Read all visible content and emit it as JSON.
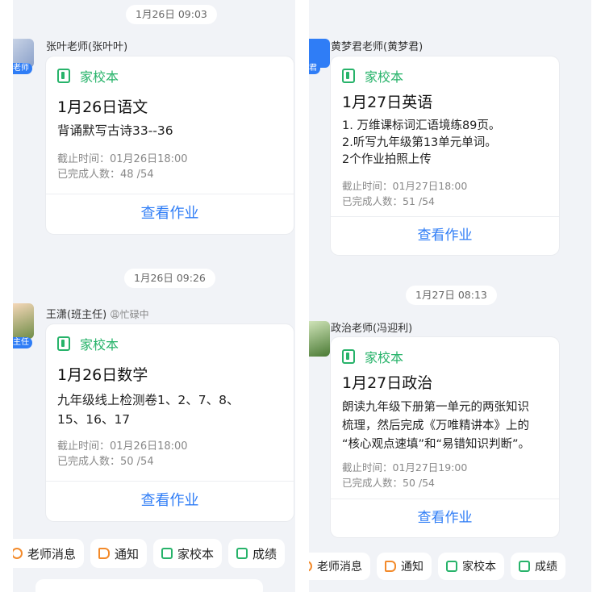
{
  "left": {
    "top_time": "1月26日 09:03",
    "messages": [
      {
        "avatar_tag": "老师",
        "sender": "张叶老师(张叶叶)",
        "busy": "",
        "app_name": "家校本",
        "title": "1月26日语文",
        "body": [
          "背诵默写古诗33--36"
        ],
        "deadline": "截止时间：01月26日18:00",
        "completed": "已完成人数：48 /54",
        "action": "查看作业"
      },
      {
        "time": "1月26日 09:26",
        "avatar_tag": "主任",
        "sender": "王潇(班主任)",
        "busy": "😩忙碌中",
        "app_name": "家校本",
        "title": "1月26日数学",
        "body": [
          "九年级线上检测卷1、2、7、8、",
          "15、16、17"
        ],
        "deadline": "截止时间：01月26日18:00",
        "completed": "已完成人数：50 /54",
        "action": "查看作业"
      }
    ],
    "toolbar": [
      {
        "icon": "message-icon",
        "label": "老师消息"
      },
      {
        "icon": "notice-icon",
        "label": "通知"
      },
      {
        "icon": "homework-icon",
        "label": "家校本"
      },
      {
        "icon": "grade-icon",
        "label": "成绩"
      }
    ]
  },
  "right": {
    "messages": [
      {
        "avatar_tag": "君",
        "sender": "黄梦君老师(黄梦君)",
        "busy": "",
        "app_name": "家校本",
        "title": "1月27日英语",
        "body": [
          "1. 万维课标词汇语境练89页。",
          "2.听写九年级第13单元单词。",
          "2个作业拍照上传"
        ],
        "deadline": "截止时间：01月27日18:00",
        "completed": "已完成人数：51 /54",
        "action": "查看作业"
      },
      {
        "time": "1月27日 08:13",
        "avatar_tag": "",
        "sender": "政治老师(冯迎利)",
        "busy": "",
        "app_name": "家校本",
        "title": "1月27日政治",
        "body": [
          "朗读九年级下册第一单元的两张知识",
          "梳理，然后完成《万唯精讲本》上的",
          "“核心观点速填”和“易错知识判断”。"
        ],
        "deadline": "截止时间：01月27日19:00",
        "completed": "已完成人数：50 /54",
        "action": "查看作业"
      }
    ],
    "toolbar": [
      {
        "icon": "message-icon",
        "label": "老师消息"
      },
      {
        "icon": "notice-icon",
        "label": "通知"
      },
      {
        "icon": "homework-icon",
        "label": "家校本"
      },
      {
        "icon": "grade-icon",
        "label": "成绩"
      }
    ]
  },
  "colors": {
    "accent": "#2f7df6",
    "app_green": "#27b36a",
    "notice_orange": "#f38a2a"
  }
}
